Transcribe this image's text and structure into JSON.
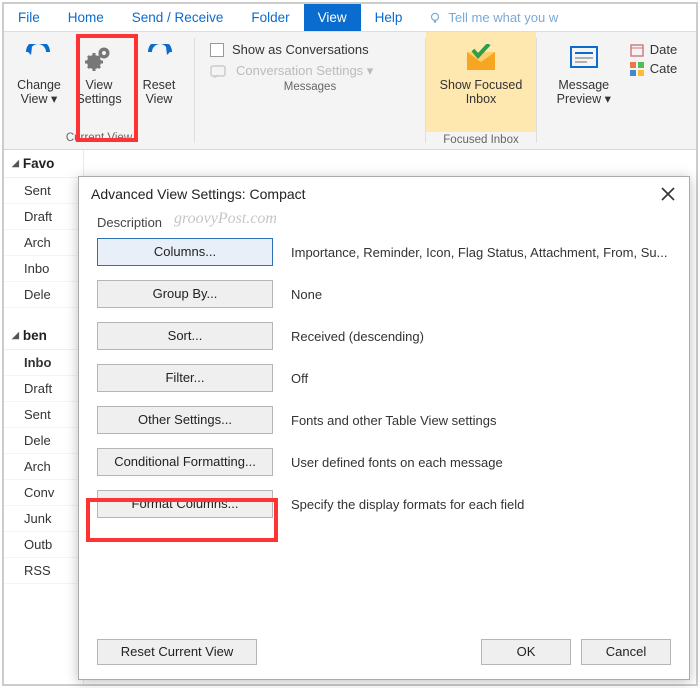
{
  "tabs": {
    "file": "File",
    "home": "Home",
    "sendreceive": "Send / Receive",
    "folder": "Folder",
    "view": "View",
    "help": "Help",
    "tell": "Tell me what you w"
  },
  "ribbon": {
    "current_view": {
      "label": "Current View",
      "change_view1": "Change",
      "change_view2": "View ▾",
      "view_settings1": "View",
      "view_settings2": "Settings",
      "reset_view1": "Reset",
      "reset_view2": "View"
    },
    "messages": {
      "label": "Messages",
      "show_as_conv": "Show as Conversations",
      "conv_settings": "Conversation Settings ▾"
    },
    "focused": {
      "label": "Focused Inbox",
      "btn1": "Show Focused",
      "btn2": "Inbox"
    },
    "arrangement": {
      "msg_prev1": "Message",
      "msg_prev2": "Preview ▾",
      "date": "Date",
      "cate": "Cate"
    }
  },
  "nav": {
    "fav": "Favo",
    "sent": "Sent",
    "draft": "Draft",
    "arch": "Arch",
    "inbo": "Inbo",
    "dele": "Dele",
    "ben": "ben",
    "inbo2": "Inbo",
    "draft2": "Draft",
    "sent2": "Sent",
    "dele2": "Dele",
    "arch2": "Arch",
    "conv": "Conv",
    "junk": "Junk",
    "outb": "Outb",
    "rss": "RSS"
  },
  "dialog": {
    "title": "Advanced View Settings: Compact",
    "description_label": "Description",
    "rows": {
      "columns": {
        "btn": "Columns...",
        "desc": "Importance, Reminder, Icon, Flag Status, Attachment, From, Su..."
      },
      "groupby": {
        "btn": "Group By...",
        "desc": "None"
      },
      "sort": {
        "btn": "Sort...",
        "desc": "Received (descending)"
      },
      "filter": {
        "btn": "Filter...",
        "desc": "Off"
      },
      "other": {
        "btn": "Other Settings...",
        "desc": "Fonts and other Table View settings"
      },
      "cond": {
        "btn": "Conditional Formatting...",
        "desc": "User defined fonts on each message"
      },
      "format": {
        "btn": "Format Columns...",
        "desc": "Specify the display formats for each field"
      }
    },
    "reset": "Reset Current View",
    "ok": "OK",
    "cancel": "Cancel"
  },
  "watermark": "groovyPost.com"
}
